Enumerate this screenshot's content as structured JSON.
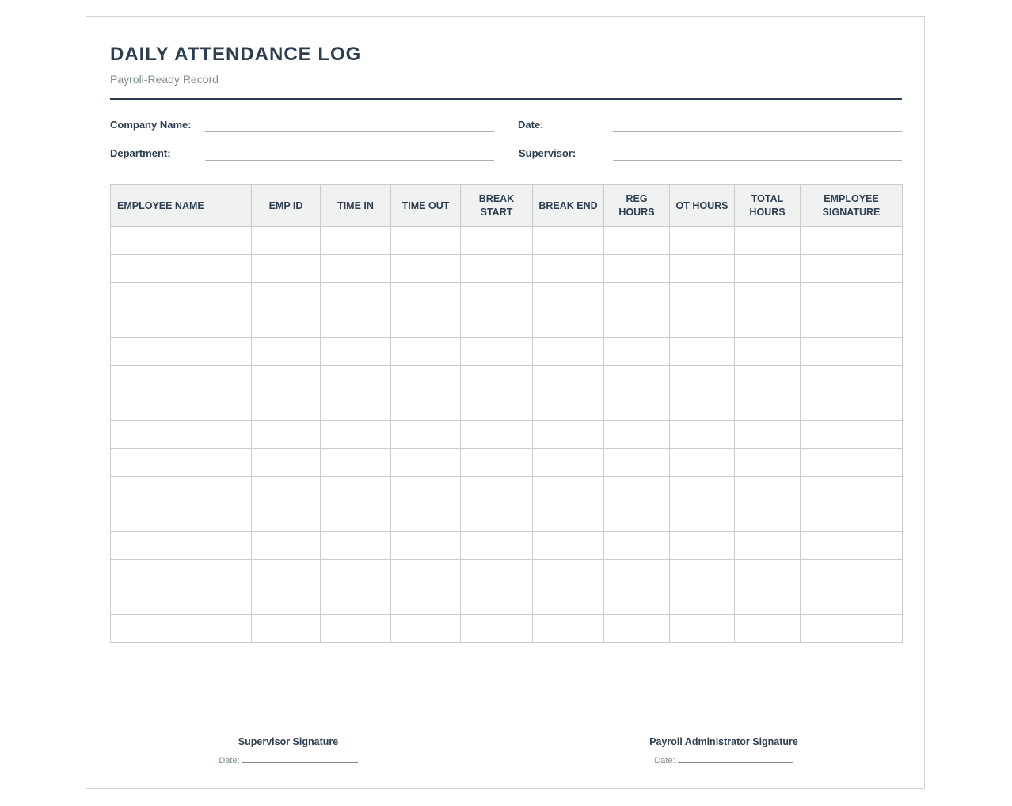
{
  "header": {
    "title": "DAILY ATTENDANCE LOG",
    "subtitle": "Payroll-Ready Record"
  },
  "fields": {
    "company_name": "Company Name:",
    "date": "Date:",
    "department": "Department:",
    "supervisor": "Supervisor:"
  },
  "table": {
    "columns": [
      "EMPLOYEE NAME",
      "EMP ID",
      "TIME IN",
      "TIME OUT",
      "BREAK START",
      "BREAK END",
      "REG HOURS",
      "OT HOURS",
      "TOTAL HOURS",
      "EMPLOYEE SIGNATURE"
    ],
    "empty_rows": 15
  },
  "signatures": {
    "supervisor": "Supervisor Signature",
    "payroll_admin": "Payroll Administrator Signature",
    "date_label": "Date:"
  },
  "colors": {
    "ink": "#2c3e50",
    "muted": "#7f8c8d",
    "header_fill": "#f0f2f2",
    "grid": "#c8cccf"
  }
}
